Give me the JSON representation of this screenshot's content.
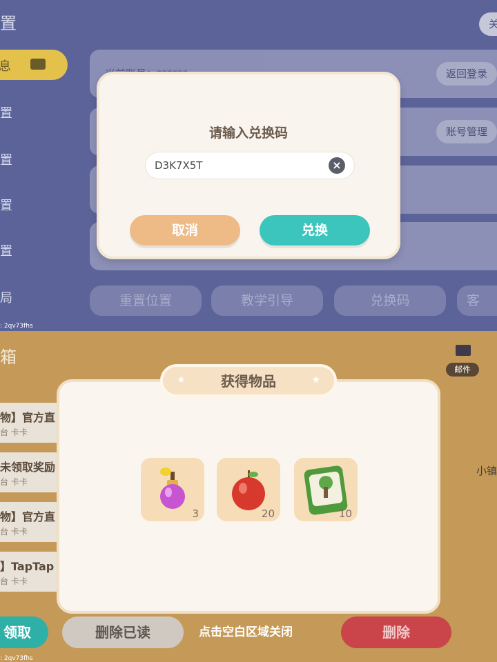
{
  "top_bg": {
    "header_char": "置",
    "right_corner": "关",
    "sidebar_items": [
      "息",
      "置",
      "置",
      "置",
      "置",
      "局"
    ],
    "row1_text": "当前账号：******",
    "row_buttons": [
      "返回登录",
      "账号管理"
    ],
    "bottom_buttons": [
      "重置位置",
      "教学引导",
      "兑换码",
      "客"
    ],
    "uid": ": 2qv73fhs"
  },
  "bottom_bg": {
    "header_char": "箱",
    "mail_label": "邮件",
    "right_text": "小镇",
    "list_items": [
      {
        "title": "物】官方直",
        "sub": "台 卡卡"
      },
      {
        "title": "未领取奖励",
        "sub": "台 卡卡"
      },
      {
        "title": "物】官方直",
        "sub": "台 卡卡"
      },
      {
        "title": "】TapTap",
        "sub": "台 卡卡"
      }
    ],
    "left_button": "领取",
    "delete_read": "删除已读",
    "delete": "删除",
    "uid": ": 2qv73fhs"
  },
  "redeem_dialog": {
    "title": "请输入兑换码",
    "code_value": "D3K7X5T",
    "cancel_label": "取消",
    "confirm_label": "兑换"
  },
  "reward_dialog": {
    "title": "获得物品",
    "items": [
      {
        "icon": "perfume-bottle-icon",
        "count": "3"
      },
      {
        "icon": "apple-icon",
        "count": "20"
      },
      {
        "icon": "tree-seed-packet-icon",
        "count": "10"
      }
    ],
    "close_hint": "点击空白区域关闭"
  },
  "colors": {
    "cancel": "#eebb87",
    "confirm": "#3cc5bd",
    "delete": "#c9454a"
  }
}
